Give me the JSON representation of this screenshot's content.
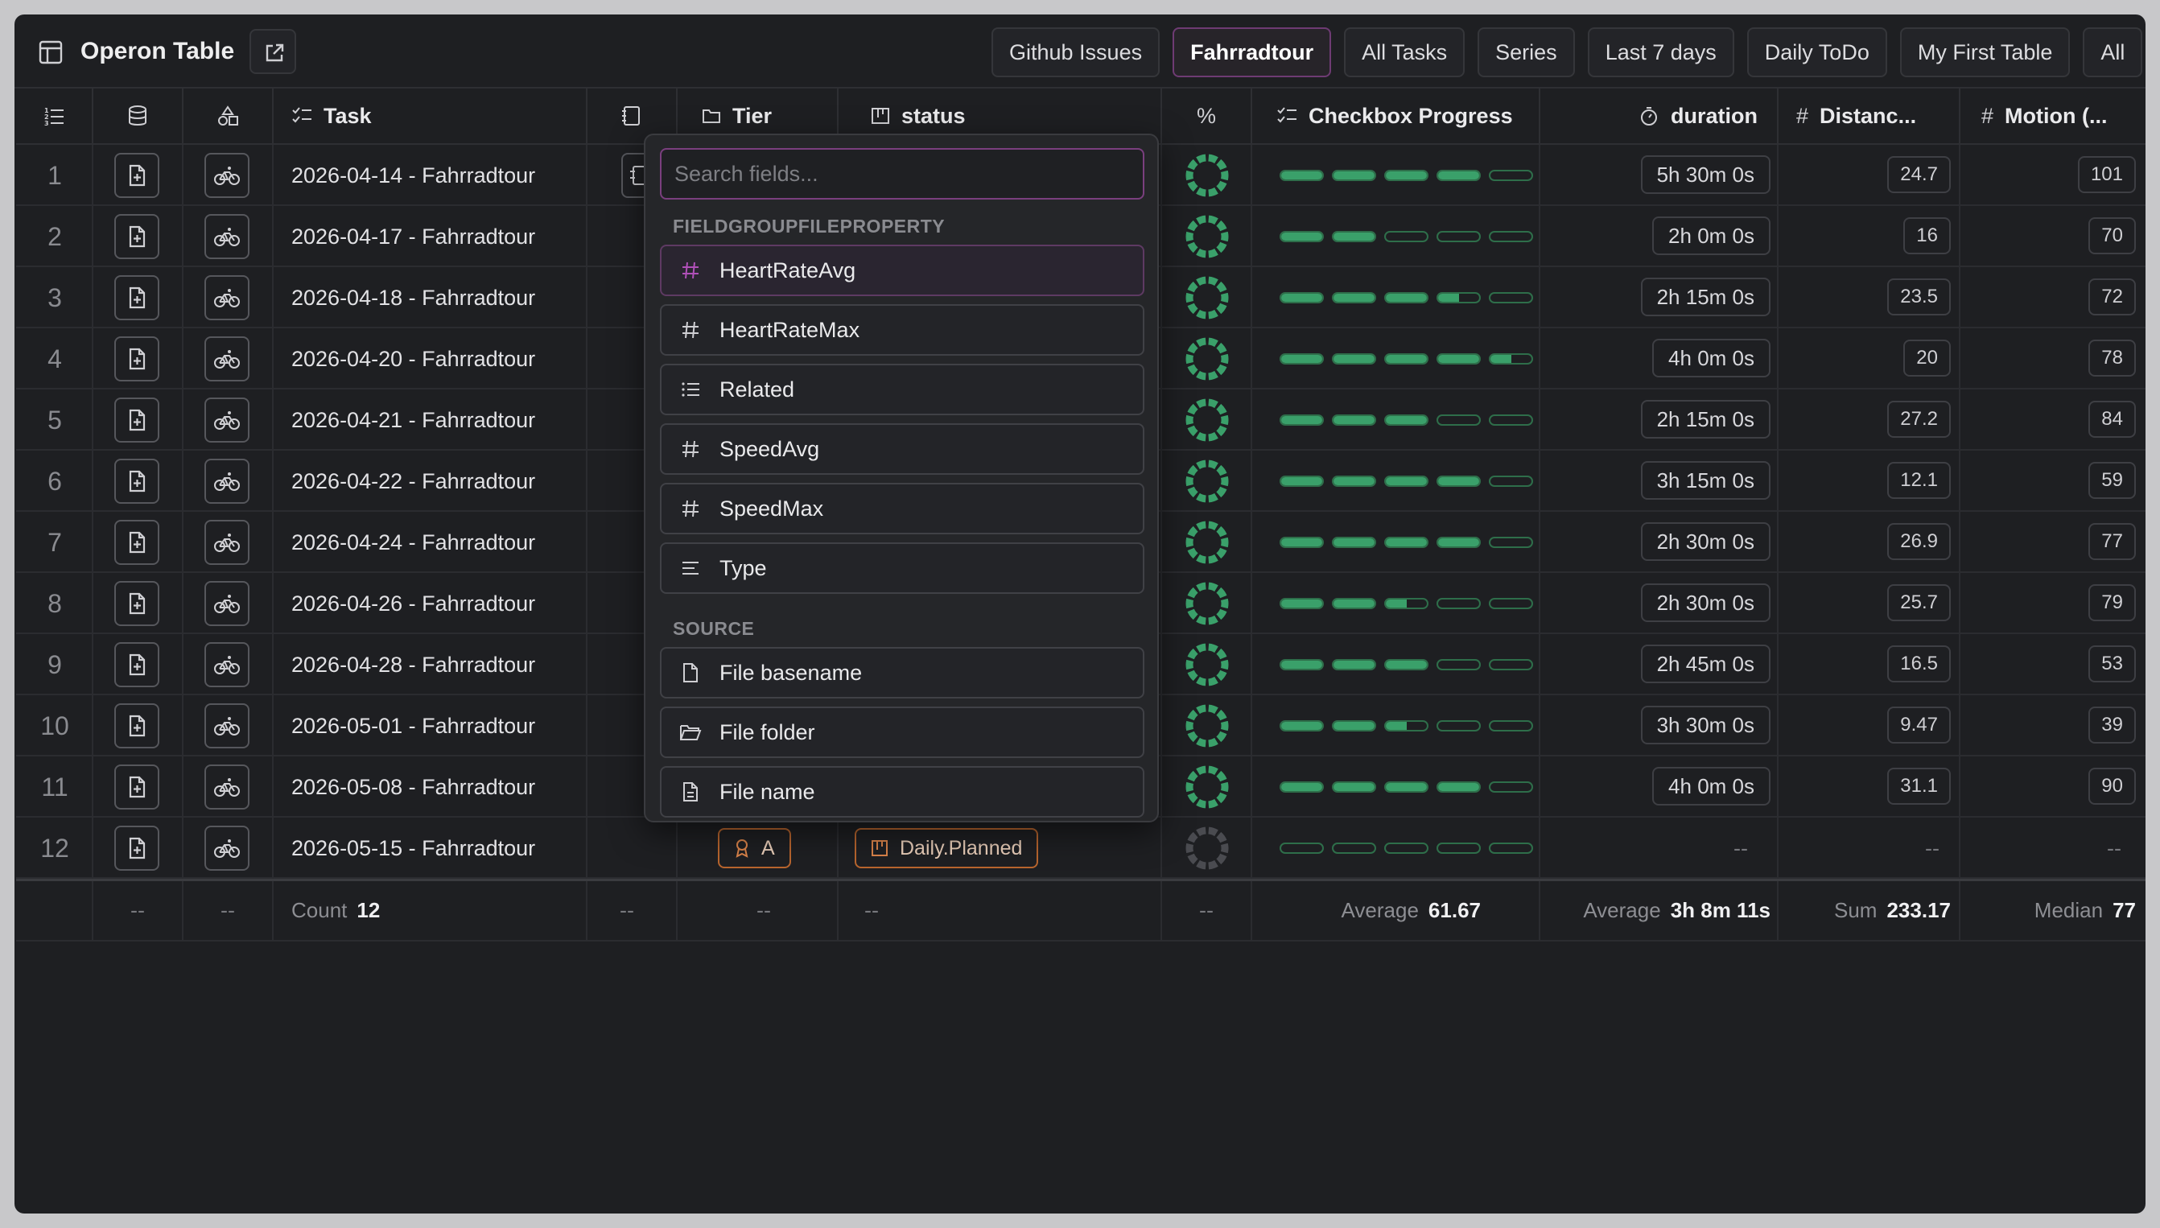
{
  "app": {
    "title": "Operon Table",
    "open_external_icon": "external-link-icon"
  },
  "tabs": [
    "Github Issues",
    "Fahrradtour",
    "All Tasks",
    "Series",
    "Last 7 days",
    "Daily ToDo",
    "My First Table",
    "All"
  ],
  "active_tab": "Fahrradtour",
  "columns": {
    "task": "Task",
    "tier": "Tier",
    "status": "status",
    "percent": "%",
    "checkbox_progress": "Checkbox Progress",
    "duration": "duration",
    "distance": "Distanc...",
    "motion": "Motion (..."
  },
  "rows": [
    {
      "num": "1",
      "task": "2026-04-14 - Fahrradtour",
      "progress": 0.8,
      "donut": 1,
      "duration": "5h 30m 0s",
      "distance": "24.7",
      "motion": "101"
    },
    {
      "num": "2",
      "task": "2026-04-17 - Fahrradtour",
      "progress": 0.4,
      "donut": 1,
      "duration": "2h 0m 0s",
      "distance": "16",
      "motion": "70"
    },
    {
      "num": "3",
      "task": "2026-04-18 - Fahrradtour",
      "progress": 0.7,
      "donut": 1,
      "duration": "2h 15m 0s",
      "distance": "23.5",
      "motion": "72"
    },
    {
      "num": "4",
      "task": "2026-04-20 - Fahrradtour",
      "progress": 0.9,
      "donut": 1,
      "duration": "4h 0m 0s",
      "distance": "20",
      "motion": "78"
    },
    {
      "num": "5",
      "task": "2026-04-21 - Fahrradtour",
      "progress": 0.6,
      "donut": 1,
      "duration": "2h 15m 0s",
      "distance": "27.2",
      "motion": "84"
    },
    {
      "num": "6",
      "task": "2026-04-22 - Fahrradtour",
      "progress": 0.8,
      "donut": 1,
      "duration": "3h 15m 0s",
      "distance": "12.1",
      "motion": "59"
    },
    {
      "num": "7",
      "task": "2026-04-24 - Fahrradtour",
      "progress": 0.8,
      "donut": 1,
      "duration": "2h 30m 0s",
      "distance": "26.9",
      "motion": "77"
    },
    {
      "num": "8",
      "task": "2026-04-26 - Fahrradtour",
      "progress": 0.5,
      "donut": 1,
      "duration": "2h 30m 0s",
      "distance": "25.7",
      "motion": "79"
    },
    {
      "num": "9",
      "task": "2026-04-28 - Fahrradtour",
      "progress": 0.6,
      "donut": 1,
      "duration": "2h 45m 0s",
      "distance": "16.5",
      "motion": "53"
    },
    {
      "num": "10",
      "task": "2026-05-01 - Fahrradtour",
      "progress": 0.5,
      "donut": 1,
      "duration": "3h 30m 0s",
      "distance": "9.47",
      "motion": "39"
    },
    {
      "num": "11",
      "task": "2026-05-08 - Fahrradtour",
      "progress": 0.8,
      "donut": 1,
      "duration": "4h 0m 0s",
      "distance": "31.1",
      "motion": "90"
    },
    {
      "num": "12",
      "task": "2026-05-15 - Fahrradtour",
      "progress": 0,
      "donut": 0,
      "duration": "--",
      "distance": "--",
      "motion": "--",
      "tier": "A",
      "status": "Daily.Planned"
    }
  ],
  "footer": {
    "empty": "--",
    "count_label": "Count",
    "count_value": "12",
    "avg_label": "Average",
    "avg_value": "61.67",
    "dur_label": "Average",
    "dur_value": "3h 8m 11s",
    "sum_label": "Sum",
    "sum_value": "233.17",
    "median_label": "Median",
    "median_value": "77"
  },
  "dropdown": {
    "search_placeholder": "Search fields...",
    "group1": "FIELDGROUPFILEPROPERTY",
    "group1_items": [
      {
        "label": "HeartRateAvg",
        "icon": "hash-icon"
      },
      {
        "label": "HeartRateMax",
        "icon": "hash-icon"
      },
      {
        "label": "Related",
        "icon": "list-icon"
      },
      {
        "label": "SpeedAvg",
        "icon": "hash-icon"
      },
      {
        "label": "SpeedMax",
        "icon": "hash-icon"
      },
      {
        "label": "Type",
        "icon": "text-icon"
      }
    ],
    "group2": "SOURCE",
    "group2_items": [
      {
        "label": "File basename",
        "icon": "file-icon"
      },
      {
        "label": "File folder",
        "icon": "folder-icon"
      },
      {
        "label": "File name",
        "icon": "file-text-icon"
      }
    ]
  },
  "colors": {
    "accent": "#7a3f7e",
    "progress": "#3aa06a",
    "status_tag": "#b8652e"
  }
}
